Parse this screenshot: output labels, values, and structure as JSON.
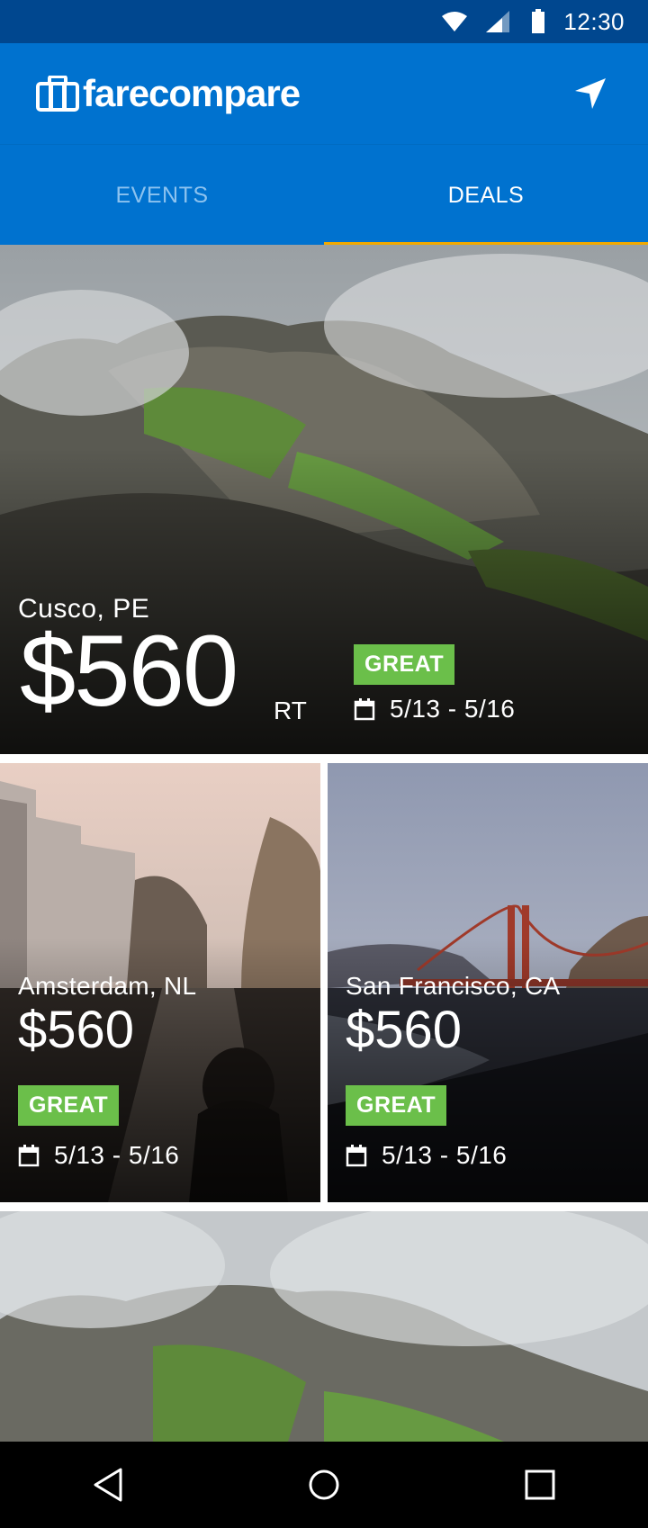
{
  "status_bar": {
    "time": "12:30"
  },
  "app_bar": {
    "logo_text": "farecompare"
  },
  "tabs": [
    {
      "label": "EVENTS",
      "active": false
    },
    {
      "label": "DEALS",
      "active": true
    }
  ],
  "deals": {
    "hero": {
      "city": "Cusco, PE",
      "price": "$560",
      "trip_type": "RT",
      "badge": "GREAT",
      "dates": "5/13 - 5/16"
    },
    "left": {
      "city": "Amsterdam, NL",
      "price": "$560",
      "badge": "GREAT",
      "dates": "5/13 - 5/16"
    },
    "right": {
      "city": "San Francisco, CA",
      "price": "$560",
      "badge": "GREAT",
      "dates": "5/13 - 5/16"
    }
  },
  "colors": {
    "status_bar": "#00478f",
    "app_bar": "#0072cf",
    "tab_indicator": "#f2a900",
    "badge_green": "#6bbf4a"
  }
}
